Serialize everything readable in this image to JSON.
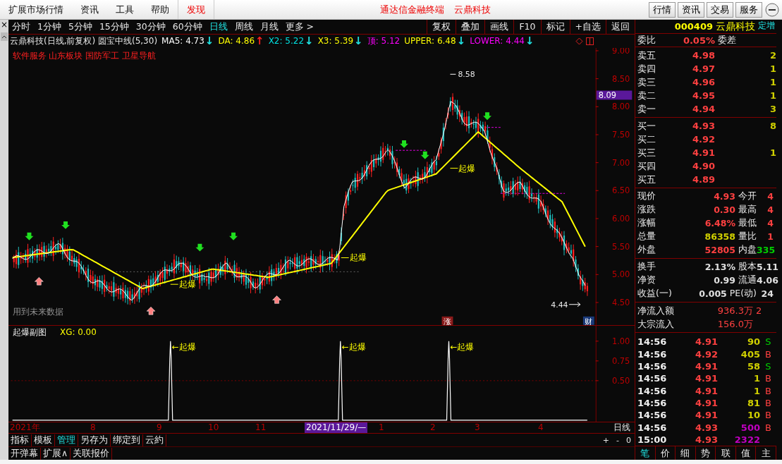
{
  "menu": [
    {
      "label": "扩展市场行情",
      "selected": false
    },
    {
      "label": "资讯",
      "selected": false
    },
    {
      "label": "工具",
      "selected": false
    },
    {
      "label": "帮助",
      "selected": false
    },
    {
      "label": "发现",
      "selected": true
    }
  ],
  "banner": [
    "通达信金融终端",
    "云鼎科技"
  ],
  "top_buttons": [
    "行情",
    "资讯",
    "交易",
    "服务"
  ],
  "close_mark": "×",
  "periods": [
    {
      "label": "分时",
      "selected": false
    },
    {
      "label": "1分钟",
      "selected": false
    },
    {
      "label": "5分钟",
      "selected": false
    },
    {
      "label": "15分钟",
      "selected": false
    },
    {
      "label": "30分钟",
      "selected": false
    },
    {
      "label": "60分钟",
      "selected": false
    },
    {
      "label": "日线",
      "selected": true
    },
    {
      "label": "周线",
      "selected": false
    },
    {
      "label": "月线",
      "selected": false
    },
    {
      "label": "更多 >",
      "selected": false
    }
  ],
  "toolbar": [
    "复权",
    "叠加",
    "画线",
    "F10",
    "标记",
    "+自选",
    "返回"
  ],
  "indicator_title": "云鼎科技(日线,前复权) 圆宝中线(5,30)",
  "indicators": [
    {
      "text": "MA5: 4.73",
      "color": "#ffffff",
      "arrow": {
        "symbol": "↓",
        "color": "#20e0e0"
      }
    },
    {
      "text": "DA: 4.86",
      "color": "#ffff00",
      "arrow": {
        "symbol": "↑",
        "color": "#ff2020"
      }
    },
    {
      "text": "X2: 5.22",
      "color": "#00e0e0",
      "arrow": {
        "symbol": "↓",
        "color": "#20e0e0"
      }
    },
    {
      "text": "X3: 5.39",
      "color": "#ffff00",
      "arrow": {
        "symbol": "↓",
        "color": "#20e0e0"
      }
    },
    {
      "text": "顶: 5.12",
      "color": "#ff00ff"
    },
    {
      "text": "UPPER: 6.48",
      "color": "#ffff00",
      "arrow": {
        "symbol": "↓",
        "color": "#20e0e0"
      }
    },
    {
      "text": "LOWER: 4.44",
      "color": "#ff00ff",
      "arrow": {
        "symbol": "↓",
        "color": "#20e0e0"
      }
    }
  ],
  "main_chart": {
    "sectors": "软件服务 山东板块 国防军工 卫星导航",
    "high": "8.58",
    "low": "4.44",
    "signals": [
      "起爆",
      "起爆",
      "起爆"
    ],
    "note": "用到未来数据",
    "badges": [
      "涨",
      "财"
    ],
    "price_tag": "8.09",
    "axis": [
      "9.00",
      "8.50",
      "8.00",
      "7.50",
      "7.00",
      "6.50",
      "6.00",
      "5.50",
      "5.00",
      "4.50"
    ]
  },
  "sub_chart": {
    "title": "起爆副图",
    "reading": "XG: 0.00",
    "labels": [
      "←起爆",
      "←起爆",
      "←起爆"
    ],
    "axis": [
      "1.00",
      "0.75",
      "0.50"
    ]
  },
  "time_axis": {
    "labels": [
      "2021年",
      "8",
      "9",
      "10",
      "11",
      "1",
      "2",
      "3",
      "4"
    ],
    "cursor": "2021/11/29/—",
    "period": "日线"
  },
  "bottom_tabs": [
    {
      "label": "指标",
      "selected": false
    },
    {
      "label": "模板",
      "selected": false
    },
    {
      "label": "管理",
      "selected": true
    },
    {
      "label": "另存为",
      "selected": false
    },
    {
      "label": "绑定到",
      "selected": false
    },
    {
      "label": "云約",
      "selected": false
    }
  ],
  "zoom_controls": [
    "+",
    "-",
    "0"
  ],
  "footer_tabs": [
    "开弹幕",
    "扩展∧",
    "关联报价"
  ],
  "quote": {
    "code": "000409",
    "name": "云鼎科技",
    "tag": "定增",
    "ratio": {
      "label": "委比",
      "value": "0.05%",
      "label2": "委差"
    },
    "asks": [
      {
        "label": "卖五",
        "price": "4.98",
        "volume": "2"
      },
      {
        "label": "卖四",
        "price": "4.97",
        "volume": "1"
      },
      {
        "label": "卖三",
        "price": "4.96",
        "volume": "1"
      },
      {
        "label": "卖二",
        "price": "4.95",
        "volume": "1"
      },
      {
        "label": "卖一",
        "price": "4.94",
        "volume": "3"
      }
    ],
    "bids": [
      {
        "label": "买一",
        "price": "4.93",
        "volume": "8"
      },
      {
        "label": "买二",
        "price": "4.92"
      },
      {
        "label": "买三",
        "price": "4.91",
        "volume": "1"
      },
      {
        "label": "买四",
        "price": "4.90"
      },
      {
        "label": "买五",
        "price": "4.89"
      }
    ],
    "stats": [
      {
        "cells": [
          {
            "label": "现价",
            "value": "4.93",
            "color": "#ff4040"
          },
          {
            "label": "今开",
            "value": "4",
            "color": "#ff4040"
          }
        ]
      },
      {
        "cells": [
          {
            "label": "涨跌",
            "value": "0.30",
            "color": "#ff4040"
          },
          {
            "label": "最高",
            "value": "4",
            "color": "#ff4040"
          }
        ]
      },
      {
        "cells": [
          {
            "label": "涨幅",
            "value": "6.48%",
            "color": "#ff4040"
          },
          {
            "label": "最低",
            "value": "4",
            "color": "#ff4040"
          }
        ]
      },
      {
        "cells": [
          {
            "label": "总量",
            "value": "86358",
            "color": "#d0d000"
          },
          {
            "label": "量比",
            "value": "1",
            "color": "#ff4040"
          }
        ]
      },
      {
        "cells": [
          {
            "label": "外盘",
            "value": "52805",
            "color": "#ff4040"
          },
          {
            "label": "内盘",
            "value": "335",
            "color": "#00d000"
          }
        ]
      }
    ],
    "stats2": [
      {
        "cells": [
          {
            "label": "换手",
            "value": "2.13%",
            "color": "#e0e0e0"
          },
          {
            "label": "股本",
            "value": "5.11",
            "color": "#e0e0e0"
          }
        ]
      },
      {
        "cells": [
          {
            "label": "净资",
            "value": "0.99",
            "color": "#e0e0e0"
          },
          {
            "label": "流通",
            "value": "4.06",
            "color": "#e0e0e0"
          }
        ]
      },
      {
        "cells": [
          {
            "label": "收益(一)",
            "value": "0.005",
            "color": "#e0e0e0"
          },
          {
            "label": "PE(动)",
            "value": "24",
            "color": "#e0e0e0"
          }
        ]
      }
    ],
    "flows": [
      {
        "label": "净流入额",
        "value": "936.3万",
        "extra": "2"
      },
      {
        "label": "大宗流入",
        "value": "156.0万"
      }
    ],
    "ticks": [
      {
        "time": "14:56",
        "price": "4.91",
        "volume": "90",
        "large": false,
        "side": "S",
        "kind": "sell"
      },
      {
        "time": "14:56",
        "price": "4.92",
        "volume": "405",
        "large": false,
        "side": "B",
        "kind": "buy"
      },
      {
        "time": "14:56",
        "price": "4.91",
        "volume": "58",
        "large": false,
        "side": "S",
        "kind": "sell"
      },
      {
        "time": "14:56",
        "price": "4.91",
        "volume": "1",
        "large": false,
        "side": "B",
        "kind": "buy"
      },
      {
        "time": "14:56",
        "price": "4.91",
        "volume": "1",
        "large": false,
        "side": "B",
        "kind": "buy"
      },
      {
        "time": "14:56",
        "price": "4.91",
        "volume": "81",
        "large": false,
        "side": "B",
        "kind": "buy"
      },
      {
        "time": "14:56",
        "price": "4.91",
        "volume": "10",
        "large": false,
        "side": "B",
        "kind": "buy"
      },
      {
        "time": "14:56",
        "price": "4.93",
        "volume": "500",
        "large": true,
        "side": "B",
        "kind": "buy"
      },
      {
        "time": "15:00",
        "price": "4.93",
        "volume": "2322",
        "large": true,
        "kind": "none"
      }
    ],
    "tabs": [
      {
        "label": "笔",
        "selected": true
      },
      {
        "label": "价",
        "selected": false
      },
      {
        "label": "细",
        "selected": false
      },
      {
        "label": "势",
        "selected": false
      },
      {
        "label": "联",
        "selected": false
      },
      {
        "label": "值",
        "selected": false
      },
      {
        "label": "主",
        "selected": false
      }
    ]
  }
}
